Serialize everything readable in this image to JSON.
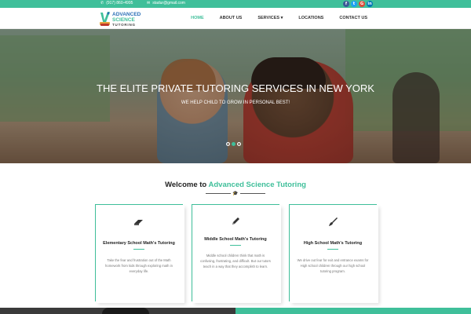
{
  "topbar": {
    "phone": "(917) 860-4995",
    "email": "stadur@gmail.com",
    "social": [
      {
        "name": "facebook-icon",
        "glyph": "f",
        "color": "#3b5998"
      },
      {
        "name": "twitter-icon",
        "glyph": "t",
        "color": "#1da1f2"
      },
      {
        "name": "google-plus-icon",
        "glyph": "G",
        "color": "#dd4b39"
      },
      {
        "name": "linkedin-icon",
        "glyph": "in",
        "color": "#0077b5"
      }
    ]
  },
  "logo": {
    "line1": "ADVANCED",
    "line2": "SCIENCE",
    "line3": "TUTORING"
  },
  "nav": {
    "items": [
      {
        "label": "HOME",
        "active": true
      },
      {
        "label": "ABOUT US"
      },
      {
        "label": "SERVICES ▾"
      },
      {
        "label": "LOCATIONS"
      },
      {
        "label": "CONTACT US"
      }
    ]
  },
  "hero": {
    "title": "THE ELITE PRIVATE TUTORING SERVICES IN NEW YORK",
    "subtitle": "WE HELP CHILD TO GROW IN PERSONAL BEST!",
    "slides": 3,
    "active_slide": 2
  },
  "welcome": {
    "prefix": "Welcome to ",
    "brand": "Advanced Science Tutoring"
  },
  "cards": [
    {
      "icon": "eraser-icon",
      "title": "Elementary School Math's Tutoring",
      "text": "Take the fear and frustration out of the Math homework from kids through exploring math in everyday life."
    },
    {
      "icon": "pencil-icon",
      "title": "Middle School Math's Tutoring",
      "text": "Middle school children think that math is confusing, frustrating, and difficult. But our tutors teach in a way that they accomplish to learn."
    },
    {
      "icon": "brush-icon",
      "title": "High School Math's Tutoring",
      "text": "We drive out fear for exit and entrance exams for High school children through our high school tutoring program."
    }
  ],
  "colors": {
    "accent": "#3fbf9a",
    "brand_blue": "#2b6fb6"
  }
}
